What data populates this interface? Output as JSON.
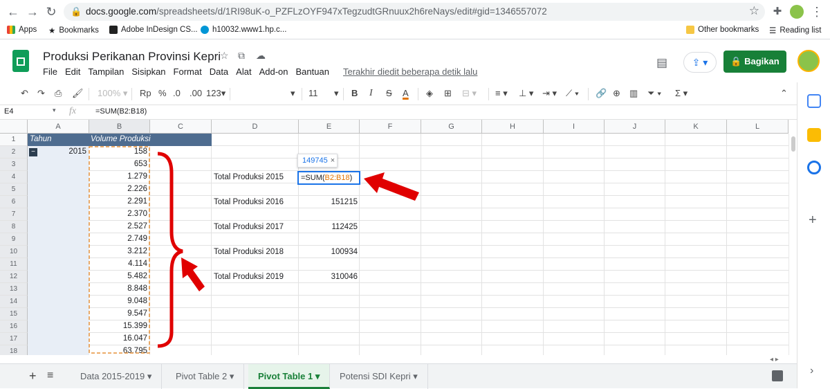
{
  "browser": {
    "url_host": "docs.google.com",
    "url_path": "/spreadsheets/d/1RI98uK-o_PZFLzOYF947xTegzudtGRnuux2h6reNays/edit#gid=1346557072",
    "bookmarks": [
      "Apps",
      "Bookmarks",
      "Adobe InDesign CS...",
      "h10032.www1.hp.c..."
    ],
    "other_bookmarks": "Other bookmarks",
    "reading_list": "Reading list"
  },
  "doc": {
    "title": "Produksi Perikanan Provinsi Kepri",
    "menu": [
      "File",
      "Edit",
      "Tampilan",
      "Sisipkan",
      "Format",
      "Data",
      "Alat",
      "Add-on",
      "Bantuan"
    ],
    "last_edit": "Terakhir diedit beberapa detik lalu",
    "share_label": "Bagikan"
  },
  "toolbar": {
    "zoom": "100%",
    "currency": "Rp",
    "percent": "%",
    "dec_less": ".0",
    "dec_more": ".00",
    "format_more": "123",
    "font_size": "11"
  },
  "formula_bar": {
    "name_box": "E4",
    "fx": "fx",
    "formula": "=SUM(B2:B18)"
  },
  "grid": {
    "columns": [
      "A",
      "B",
      "C",
      "D",
      "E",
      "F",
      "G",
      "H",
      "I",
      "J",
      "K",
      "L"
    ],
    "rows": [
      "1",
      "2",
      "3",
      "4",
      "5",
      "6",
      "7",
      "8",
      "9",
      "10",
      "11",
      "12",
      "13",
      "14",
      "15",
      "16",
      "17",
      "18"
    ],
    "header_a": "Tahun",
    "header_b": "Volume Produksi",
    "year": "2015",
    "volumes": [
      "158",
      "653",
      "1.279",
      "2.226",
      "2.291",
      "2.370",
      "2.527",
      "2.749",
      "3.212",
      "4.114",
      "5.482",
      "8.848",
      "9.048",
      "9.547",
      "15.399",
      "16.047",
      "63.795"
    ],
    "totals": [
      {
        "label": "Total Produksi 2015",
        "value": ""
      },
      {
        "label": "Total Produksi 2016",
        "value": "151215"
      },
      {
        "label": "Total Produksi 2017",
        "value": "112425"
      },
      {
        "label": "Total Produksi 2018",
        "value": "100934"
      },
      {
        "label": "Total Produksi 2019",
        "value": "310046"
      }
    ],
    "tooltip_value": "149745",
    "edit_prefix": "=SUM(",
    "edit_ref": "B2:B18",
    "edit_suffix": ")"
  },
  "sheets": {
    "tabs": [
      "Data 2015-2019",
      "Pivot Table 2",
      "Pivot Table 1",
      "Potensi SDI Kepri"
    ],
    "active_index": 2
  },
  "colors": {
    "header_bg": "#4e6c8f",
    "annotation_red": "#e00000",
    "selection_orange": "#e69138",
    "share_green": "#188038"
  }
}
